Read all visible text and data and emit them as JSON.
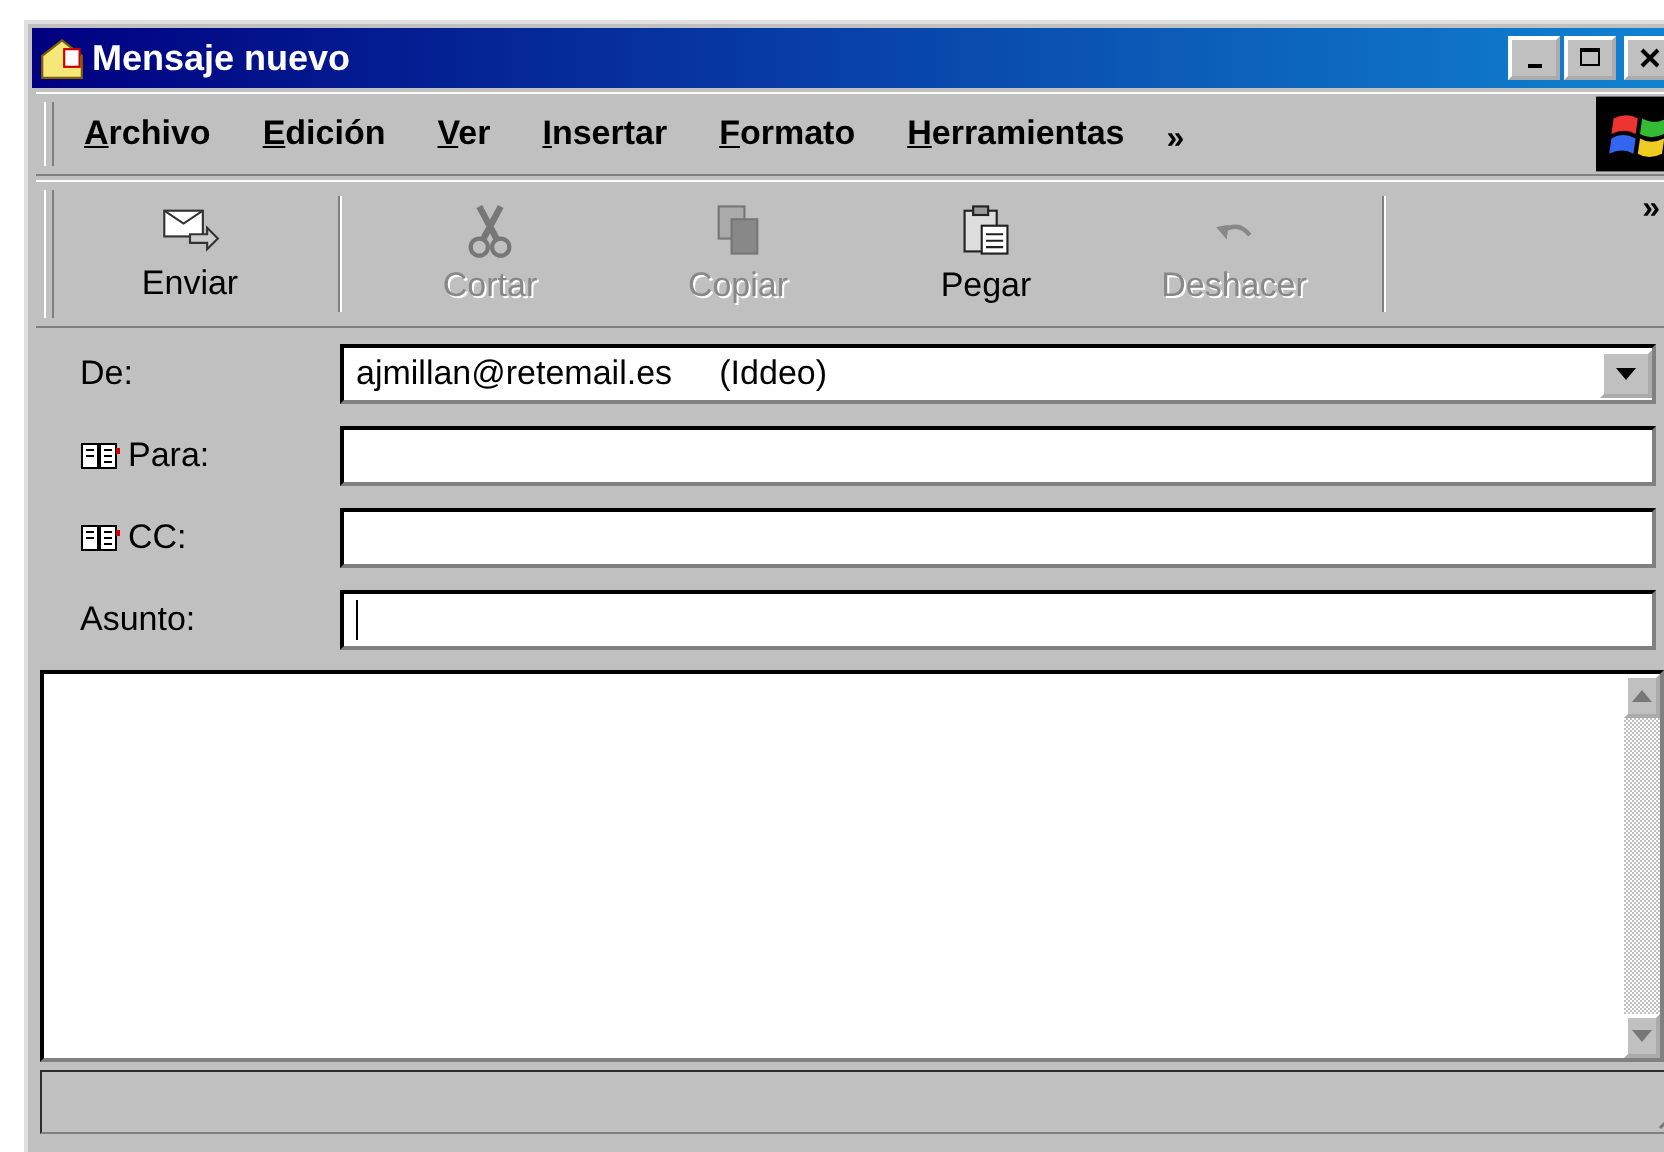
{
  "window": {
    "title": "Mensaje nuevo"
  },
  "menu": [
    {
      "label": "Archivo"
    },
    {
      "label": "Edición"
    },
    {
      "label": "Ver"
    },
    {
      "label": "Insertar"
    },
    {
      "label": "Formato"
    },
    {
      "label": "Herramientas"
    }
  ],
  "menu_more": "»",
  "toolbar": [
    {
      "kind": "send",
      "label": "Enviar",
      "disabled": false
    },
    {
      "kind": "separator"
    },
    {
      "kind": "cut",
      "label": "Cortar",
      "disabled": true
    },
    {
      "kind": "copy",
      "label": "Copiar",
      "disabled": true
    },
    {
      "kind": "paste",
      "label": "Pegar",
      "disabled": false
    },
    {
      "kind": "undo",
      "label": "Deshacer",
      "disabled": true
    },
    {
      "kind": "separator"
    }
  ],
  "toolbar_more": "»",
  "fields": [
    {
      "kind": "dropdown",
      "label": "De:",
      "book": false,
      "value": "ajmillan@retemail.es     (Iddeo)",
      "focused": false
    },
    {
      "kind": "text",
      "label": "Para:",
      "book": true,
      "focused": false
    },
    {
      "kind": "text",
      "label": "CC:",
      "book": true,
      "focused": false
    },
    {
      "kind": "text",
      "label": "Asunto:",
      "book": false,
      "focused": true
    }
  ]
}
